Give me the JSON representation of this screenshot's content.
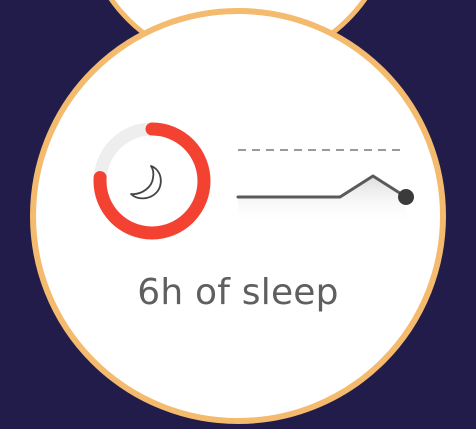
{
  "app": {
    "summary_label": "6h of sleep"
  },
  "sleep_ring": {
    "progress": 0.76,
    "icon": "crescent-moon-icon"
  },
  "colors": {
    "background": "#221c4a",
    "face_border": "#f4bb6e",
    "face_fill": "#ffffff",
    "ring_progress": "#f44232",
    "ring_track": "#eeeeee",
    "graph_line": "#5a5a5a",
    "graph_fill": "#e8e8e8",
    "caption": "#5f5f5f"
  }
}
